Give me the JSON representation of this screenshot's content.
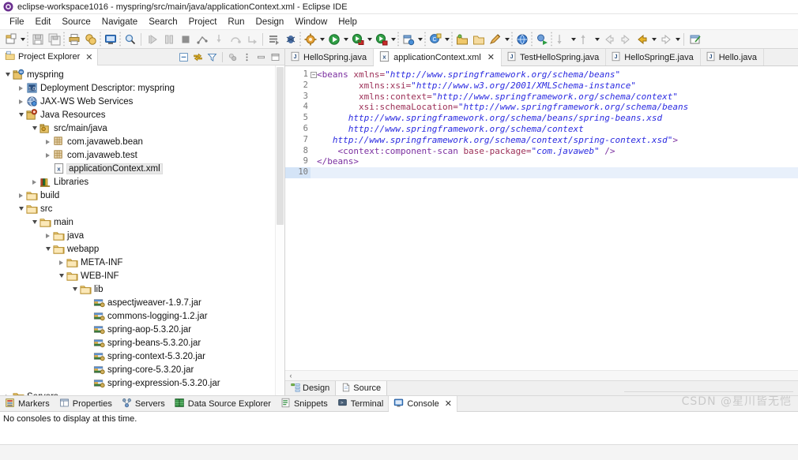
{
  "window": {
    "title": "eclipse-workspace1016 - myspring/src/main/java/applicationContext.xml - Eclipse IDE",
    "icon": "eclipse-icon"
  },
  "menubar": {
    "items": [
      "File",
      "Edit",
      "Source",
      "Navigate",
      "Search",
      "Project",
      "Run",
      "Design",
      "Window",
      "Help"
    ]
  },
  "toolbar": {
    "groups": [
      {
        "buttons": [
          {
            "name": "new-icon",
            "glyph": "new"
          },
          {
            "name": "new-dropdown-arrow",
            "glyph": "arrow"
          }
        ]
      },
      {
        "buttons": [
          {
            "name": "save-icon",
            "glyph": "save"
          },
          {
            "name": "save-all-icon",
            "glyph": "saveall"
          }
        ]
      },
      {
        "buttons": [
          {
            "name": "print-icon",
            "glyph": "print"
          },
          {
            "name": "export-icon",
            "glyph": "export"
          }
        ]
      },
      {
        "buttons": [
          {
            "name": "open-perspective-icon",
            "glyph": "screen"
          }
        ]
      },
      {
        "buttons": [
          {
            "name": "search-icon",
            "glyph": "search"
          }
        ]
      },
      {
        "buttons": [
          {
            "name": "resume-icon",
            "glyph": "resume"
          },
          {
            "name": "suspend-icon",
            "glyph": "suspend"
          },
          {
            "name": "terminate-icon",
            "glyph": "terminate"
          },
          {
            "name": "disconnect-icon",
            "glyph": "disconnect"
          },
          {
            "name": "step-into-icon",
            "glyph": "stepinto"
          },
          {
            "name": "step-over-icon",
            "glyph": "stepover"
          },
          {
            "name": "step-return-icon",
            "glyph": "stepreturn"
          }
        ]
      },
      {
        "buttons": [
          {
            "name": "server-publish-icon",
            "glyph": "publish"
          },
          {
            "name": "debug-server-icon",
            "glyph": "debugserver"
          }
        ]
      },
      {
        "buttons": [
          {
            "name": "debug-icon",
            "glyph": "bug"
          },
          {
            "name": "debug-dropdown-arrow",
            "glyph": "arrow"
          },
          {
            "name": "run-icon",
            "glyph": "run"
          },
          {
            "name": "run-dropdown-arrow",
            "glyph": "arrow"
          },
          {
            "name": "run-as-server-icon",
            "glyph": "runserver"
          },
          {
            "name": "run-as-dropdown-arrow",
            "glyph": "arrow"
          },
          {
            "name": "run-stop-icon",
            "glyph": "runstop"
          },
          {
            "name": "run-stop-dropdown-arrow",
            "glyph": "arrow"
          }
        ]
      },
      {
        "buttons": [
          {
            "name": "new-java-project-icon",
            "glyph": "javaproj"
          },
          {
            "name": "new-java-project-arrow",
            "glyph": "arrow"
          }
        ]
      },
      {
        "buttons": [
          {
            "name": "new-class-icon",
            "glyph": "newclass"
          },
          {
            "name": "new-class-arrow",
            "glyph": "arrow"
          }
        ]
      },
      {
        "buttons": [
          {
            "name": "open-type-icon",
            "glyph": "opentype"
          },
          {
            "name": "open-task-icon",
            "glyph": "opentask"
          },
          {
            "name": "edit-icon",
            "glyph": "pencil"
          },
          {
            "name": "edit-arrow",
            "glyph": "arrow"
          }
        ]
      },
      {
        "buttons": [
          {
            "name": "open-web-browser-icon",
            "glyph": "globe"
          }
        ]
      },
      {
        "buttons": [
          {
            "name": "run-last-tool-icon",
            "glyph": "runtool"
          }
        ]
      },
      {
        "buttons": [
          {
            "name": "next-annotation-icon",
            "glyph": "nextanno"
          },
          {
            "name": "next-annotation-arrow",
            "glyph": "arrow"
          },
          {
            "name": "prev-annotation-icon",
            "glyph": "prevanno"
          },
          {
            "name": "prev-annotation-arrow",
            "glyph": "arrow"
          },
          {
            "name": "back-icon",
            "glyph": "backgray"
          },
          {
            "name": "forward-icon",
            "glyph": "fwdgray"
          },
          {
            "name": "back-history-icon",
            "glyph": "backamber"
          },
          {
            "name": "back-history-arrow",
            "glyph": "arrow"
          },
          {
            "name": "forward-history-icon",
            "glyph": "fwdwhite"
          },
          {
            "name": "forward-history-arrow",
            "glyph": "arrow"
          }
        ]
      },
      {
        "buttons": [
          {
            "name": "pin-editor-icon",
            "glyph": "pin"
          }
        ]
      }
    ]
  },
  "explorer": {
    "tab_label": "Project Explorer",
    "tab_close": "✕",
    "toolbar_icons": [
      {
        "name": "collapse-all-icon"
      },
      {
        "name": "link-with-editor-icon"
      },
      {
        "name": "view-filter-icon"
      },
      {
        "name": "focus-on-active-task-icon"
      },
      {
        "name": "view-menu-icon"
      },
      {
        "name": "minimize-view-icon"
      },
      {
        "name": "maximize-view-icon"
      }
    ],
    "tree": [
      {
        "label": "myspring",
        "indent": 0,
        "twisty": "down",
        "icon": "project-icon",
        "selected": false
      },
      {
        "label": "Deployment Descriptor: myspring",
        "indent": 1,
        "twisty": "right",
        "icon": "deployment-descriptor-icon",
        "selected": false
      },
      {
        "label": "JAX-WS Web Services",
        "indent": 1,
        "twisty": "right",
        "icon": "jaxws-icon",
        "selected": false
      },
      {
        "label": "Java Resources",
        "indent": 1,
        "twisty": "down",
        "icon": "java-resources-icon",
        "selected": false
      },
      {
        "label": "src/main/java",
        "indent": 2,
        "twisty": "down",
        "icon": "source-folder-icon",
        "selected": false
      },
      {
        "label": "com.javaweb.bean",
        "indent": 3,
        "twisty": "right",
        "icon": "package-icon",
        "selected": false
      },
      {
        "label": "com.javaweb.test",
        "indent": 3,
        "twisty": "right",
        "icon": "package-icon",
        "selected": false
      },
      {
        "label": "applicationContext.xml",
        "indent": 3,
        "twisty": "none",
        "icon": "xml-file-icon",
        "selected": true
      },
      {
        "label": "Libraries",
        "indent": 2,
        "twisty": "right",
        "icon": "libraries-icon",
        "selected": false
      },
      {
        "label": "build",
        "indent": 1,
        "twisty": "right",
        "icon": "folder-icon",
        "selected": false
      },
      {
        "label": "src",
        "indent": 1,
        "twisty": "down",
        "icon": "folder-icon",
        "selected": false
      },
      {
        "label": "main",
        "indent": 2,
        "twisty": "down",
        "icon": "folder-icon",
        "selected": false
      },
      {
        "label": "java",
        "indent": 3,
        "twisty": "right",
        "icon": "folder-icon",
        "selected": false
      },
      {
        "label": "webapp",
        "indent": 3,
        "twisty": "down",
        "icon": "folder-icon",
        "selected": false
      },
      {
        "label": "META-INF",
        "indent": 4,
        "twisty": "right",
        "icon": "folder-icon",
        "selected": false
      },
      {
        "label": "WEB-INF",
        "indent": 4,
        "twisty": "down",
        "icon": "folder-icon",
        "selected": false
      },
      {
        "label": "lib",
        "indent": 5,
        "twisty": "down",
        "icon": "folder-icon",
        "selected": false
      },
      {
        "label": "aspectjweaver-1.9.7.jar",
        "indent": 6,
        "twisty": "none",
        "icon": "jar-icon",
        "selected": false
      },
      {
        "label": "commons-logging-1.2.jar",
        "indent": 6,
        "twisty": "none",
        "icon": "jar-icon",
        "selected": false
      },
      {
        "label": "spring-aop-5.3.20.jar",
        "indent": 6,
        "twisty": "none",
        "icon": "jar-icon",
        "selected": false
      },
      {
        "label": "spring-beans-5.3.20.jar",
        "indent": 6,
        "twisty": "none",
        "icon": "jar-icon",
        "selected": false
      },
      {
        "label": "spring-context-5.3.20.jar",
        "indent": 6,
        "twisty": "none",
        "icon": "jar-icon",
        "selected": false
      },
      {
        "label": "spring-core-5.3.20.jar",
        "indent": 6,
        "twisty": "none",
        "icon": "jar-icon",
        "selected": false
      },
      {
        "label": "spring-expression-5.3.20.jar",
        "indent": 6,
        "twisty": "none",
        "icon": "jar-icon",
        "selected": false
      },
      {
        "label": "Servers",
        "indent": 0,
        "twisty": "right",
        "icon": "folder-icon",
        "selected": false
      }
    ]
  },
  "editor": {
    "tabs": [
      {
        "label": "HelloSpring.java",
        "icon": "java-file-icon",
        "active": false,
        "closable": false
      },
      {
        "label": "applicationContext.xml",
        "icon": "xml-file-icon",
        "active": true,
        "closable": true
      },
      {
        "label": "TestHelloSpring.java",
        "icon": "java-file-icon",
        "active": false,
        "closable": false
      },
      {
        "label": "HelloSpringE.java",
        "icon": "java-file-icon",
        "active": false,
        "closable": false
      },
      {
        "label": "Hello.java",
        "icon": "java-file-icon",
        "active": false,
        "closable": false
      }
    ],
    "tab_close_glyph": "✕",
    "line_numbers": [
      "1",
      "2",
      "3",
      "4",
      "5",
      "6",
      "7",
      "8",
      "9",
      "10"
    ],
    "current_line": 10,
    "fold_line": 1,
    "code_lines": [
      [
        {
          "t": "tag",
          "s": "<beans "
        },
        {
          "t": "attr",
          "s": "xmlns="
        },
        {
          "t": "val",
          "s": "\"http://www.springframework.org/schema/beans\""
        }
      ],
      [
        {
          "t": "plain",
          "s": "        "
        },
        {
          "t": "attr",
          "s": "xmlns:xsi="
        },
        {
          "t": "val",
          "s": "\"http://www.w3.org/2001/XMLSchema-instance\""
        }
      ],
      [
        {
          "t": "plain",
          "s": "        "
        },
        {
          "t": "attr",
          "s": "xmlns:context="
        },
        {
          "t": "val",
          "s": "\"http://www.springframework.org/schema/context\""
        }
      ],
      [
        {
          "t": "plain",
          "s": "        "
        },
        {
          "t": "attr",
          "s": "xsi:schemaLocation="
        },
        {
          "t": "val",
          "s": "\"http://www.springframework.org/schema/beans"
        }
      ],
      [
        {
          "t": "plain",
          "s": "      "
        },
        {
          "t": "val",
          "s": "http://www.springframework.org/schema/beans/spring-beans.xsd"
        }
      ],
      [
        {
          "t": "plain",
          "s": "      "
        },
        {
          "t": "val",
          "s": "http://www.springframework.org/schema/context"
        }
      ],
      [
        {
          "t": "plain",
          "s": "   "
        },
        {
          "t": "val",
          "s": "http://www.springframework.org/schema/context/spring-context.xsd\""
        },
        {
          "t": "tag",
          "s": ">"
        }
      ],
      [
        {
          "t": "plain",
          "s": "    "
        },
        {
          "t": "tag",
          "s": "<context:component-scan "
        },
        {
          "t": "attr",
          "s": "base-package="
        },
        {
          "t": "val",
          "s": "\"com.javaweb\" "
        },
        {
          "t": "tag",
          "s": "/>"
        }
      ],
      [
        {
          "t": "tag",
          "s": "</beans>"
        }
      ],
      []
    ],
    "design_source_tabs": [
      {
        "label": "Design",
        "icon": "design-icon",
        "active": false
      },
      {
        "label": "Source",
        "icon": "source-icon",
        "active": true
      }
    ],
    "hscroll_left_glyph": "‹"
  },
  "bottom_panel": {
    "tabs": [
      {
        "label": "Markers",
        "icon": "markers-icon",
        "active": false,
        "closable": false
      },
      {
        "label": "Properties",
        "icon": "properties-icon",
        "active": false,
        "closable": false
      },
      {
        "label": "Servers",
        "icon": "servers-icon",
        "active": false,
        "closable": false
      },
      {
        "label": "Data Source Explorer",
        "icon": "data-source-explorer-icon",
        "active": false,
        "closable": false
      },
      {
        "label": "Snippets",
        "icon": "snippets-icon",
        "active": false,
        "closable": false
      },
      {
        "label": "Terminal",
        "icon": "terminal-icon",
        "active": false,
        "closable": false
      },
      {
        "label": "Console",
        "icon": "console-icon",
        "active": true,
        "closable": true
      }
    ],
    "close_glyph": "✕",
    "console_message": "No consoles to display at this time."
  },
  "watermark": {
    "text": "CSDN @星川皆无恺"
  },
  "colors": {
    "tag": "#7b2fa0",
    "attr": "#9c2f57",
    "value": "#2a2ae0",
    "selection": "#e8f0fb",
    "gutter_current": "#d4e4f7"
  }
}
